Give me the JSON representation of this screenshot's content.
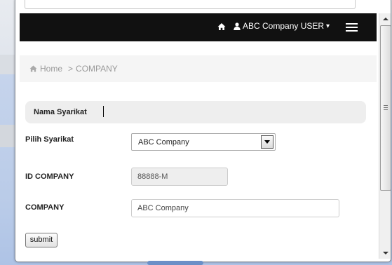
{
  "navbar": {
    "home_icon": "home-icon",
    "user_icon": "user-icon",
    "user_label": "ABC Company USER",
    "dropdown_caret": "▾",
    "menu_icon": "hamburger-menu-icon",
    "background_color": "#111111"
  },
  "breadcrumb": {
    "home_label": "Home",
    "separator": ">",
    "current": "COMPANY"
  },
  "form": {
    "section_title": "Nama Syarikat",
    "pilih_label": "Pilih Syarikat",
    "pilih_selected": "ABC Company",
    "id_label": "ID COMPANY",
    "id_value": "88888-M",
    "company_label": "COMPANY",
    "company_value": "ABC Company",
    "submit_label": "submit"
  }
}
